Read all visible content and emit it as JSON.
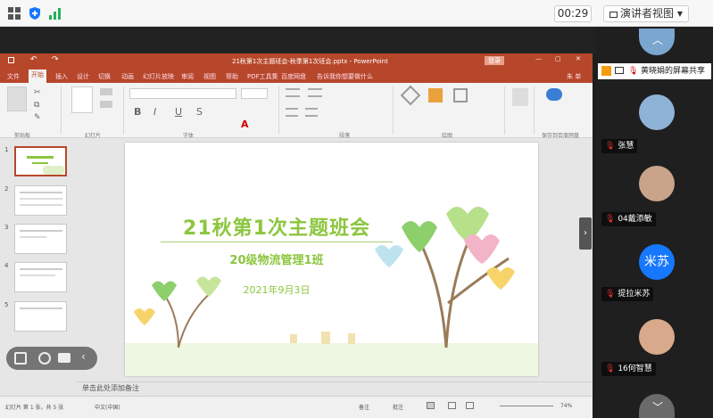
{
  "toolbar": {
    "timer": "00:29",
    "presenter_view": "演讲者视图"
  },
  "ppt": {
    "title": "21秋第1次主题班会-秋季第1次班会.pptx  -  PowerPoint",
    "login": "登录",
    "user": "朱 单",
    "tabs": [
      "文件",
      "开始",
      "插入",
      "设计",
      "切换",
      "动画",
      "幻灯片放映",
      "审阅",
      "视图",
      "帮助",
      "PDF工具集",
      "百度网盘",
      "告诉我你想要做什么"
    ],
    "groups": [
      "剪贴板",
      "幻灯片",
      "字体",
      "段落",
      "绘图",
      "保存到百度网盘"
    ],
    "notes_placeholder": "单击此处添加备注",
    "status_left": "幻灯片 第 1 张，共 5 张",
    "status_lang": "中文(中国)",
    "status_notes": "备注",
    "status_comments": "批注",
    "zoom": "74%"
  },
  "slide": {
    "title": "21秋第1次主题班会",
    "subtitle": "20级物流管理1班",
    "date": "2021年9月3日"
  },
  "thumbnails": [
    {
      "num": "1"
    },
    {
      "num": "2"
    },
    {
      "num": "3"
    },
    {
      "num": "4"
    },
    {
      "num": "5"
    }
  ],
  "participants": {
    "share_label": "黄晓娟的屏幕共享",
    "people": [
      {
        "name": "张慧",
        "color": "#8fb3d6"
      },
      {
        "name": "04戴添敏",
        "color": "#c9a48a"
      },
      {
        "name": "提拉米苏",
        "initials": "米苏",
        "color": "#1677ff"
      },
      {
        "name": "16何智慧",
        "color": "#d8a98a"
      }
    ]
  },
  "colors": {
    "ppt_red": "#b7472a",
    "slide_green": "#8cc63f",
    "panel_bg": "#1f1f1f"
  }
}
